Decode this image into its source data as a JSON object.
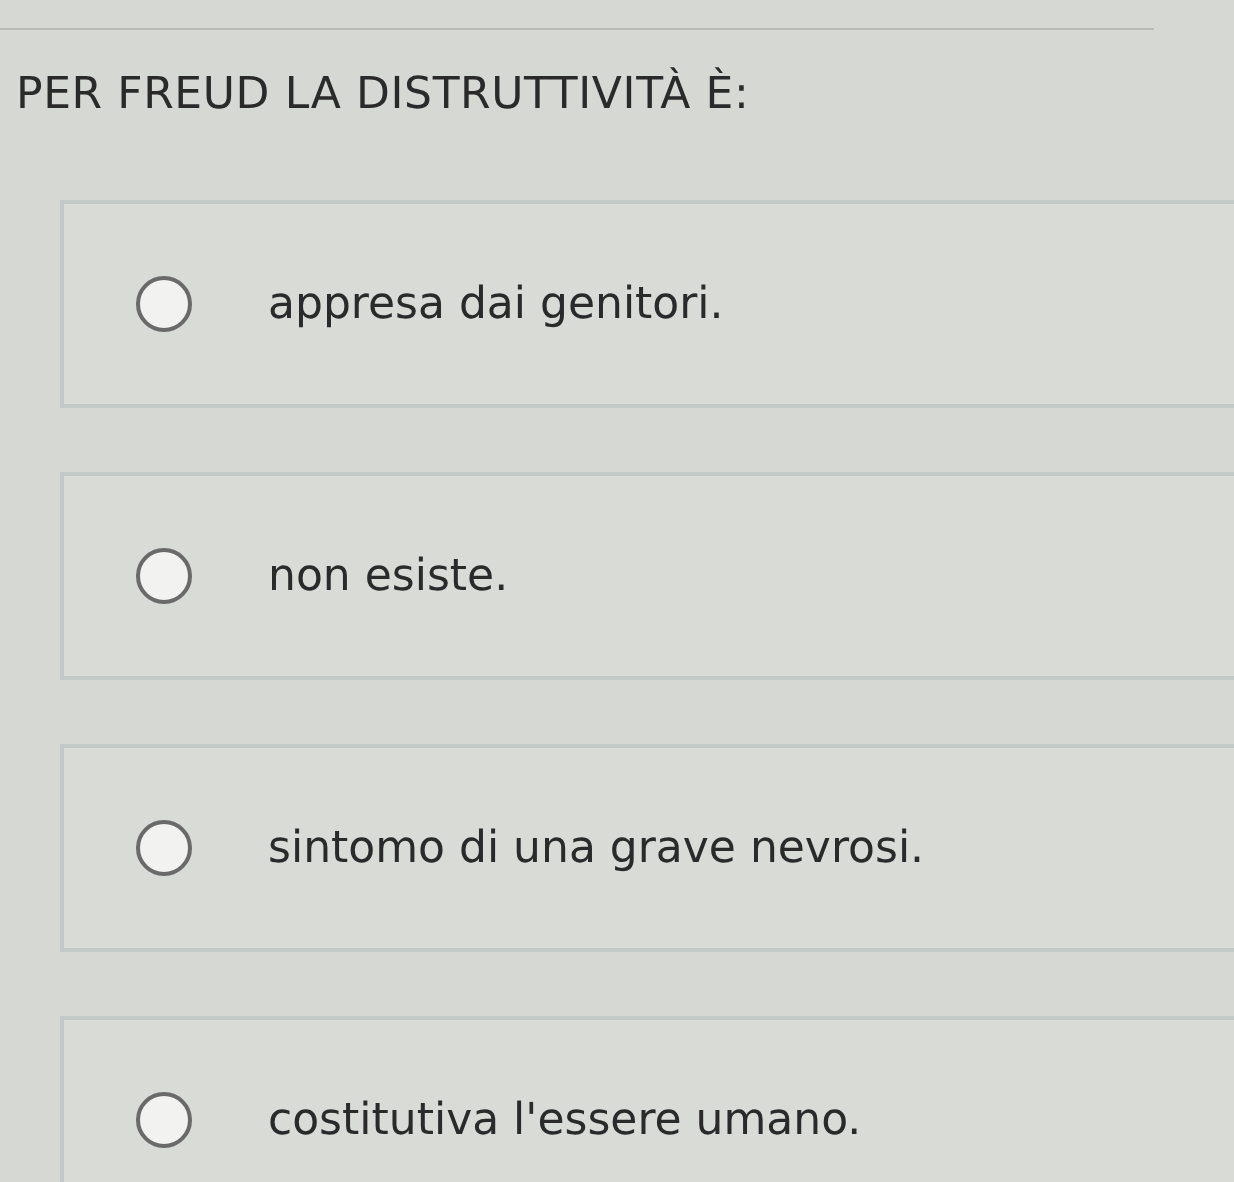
{
  "question": "PER FREUD LA DISTRUTTIVITÀ È:",
  "options": [
    {
      "text": "appresa dai genitori.",
      "selected": false
    },
    {
      "text": "non esiste.",
      "selected": false
    },
    {
      "text": "sintomo di una grave nevrosi.",
      "selected": false
    },
    {
      "text": "costitutiva l'essere umano.",
      "selected": false
    }
  ]
}
